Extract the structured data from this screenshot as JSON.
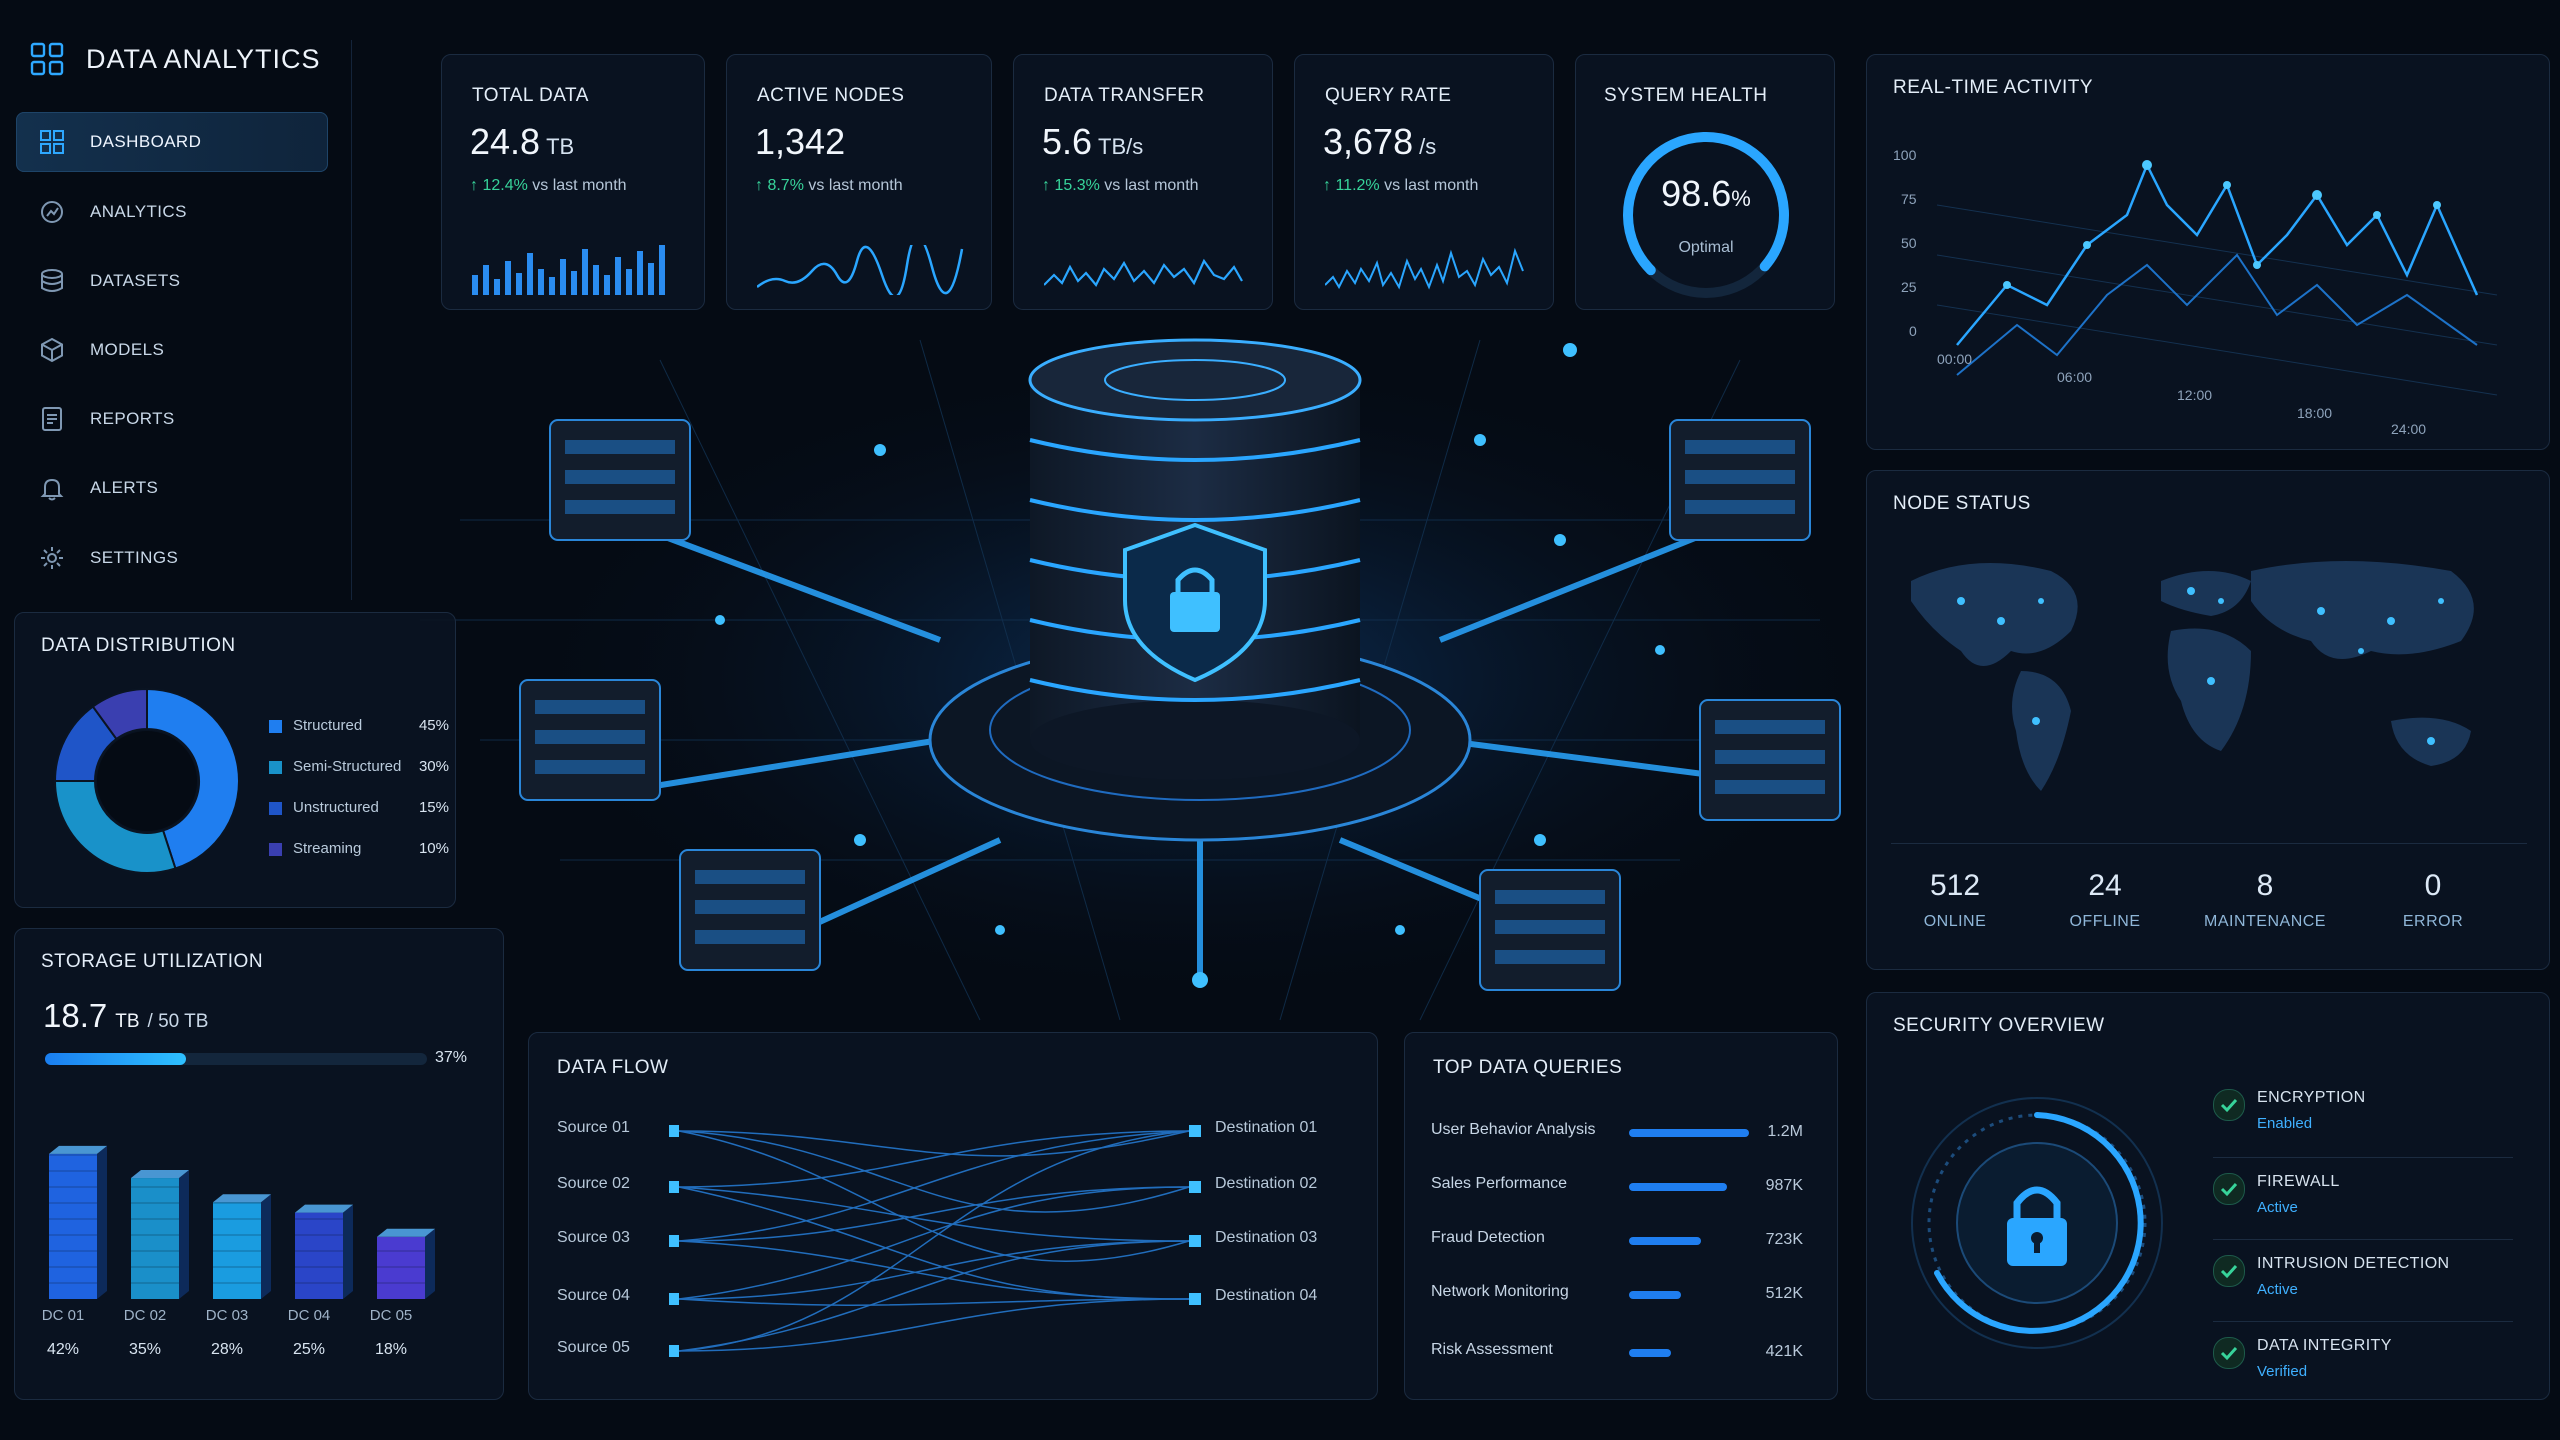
{
  "app": {
    "title": "DATA ANALYTICS"
  },
  "nav": [
    {
      "label": "DASHBOARD",
      "icon": "dashboard-icon",
      "active": true
    },
    {
      "label": "ANALYTICS",
      "icon": "analytics-icon",
      "active": false
    },
    {
      "label": "DATASETS",
      "icon": "database-icon",
      "active": false
    },
    {
      "label": "MODELS",
      "icon": "cube-icon",
      "active": false
    },
    {
      "label": "REPORTS",
      "icon": "document-icon",
      "active": false
    },
    {
      "label": "ALERTS",
      "icon": "bell-icon",
      "active": false
    },
    {
      "label": "SETTINGS",
      "icon": "gear-icon",
      "active": false
    }
  ],
  "kpis": [
    {
      "title": "TOTAL DATA",
      "value": "24.8",
      "unit": "TB",
      "delta": "12.4%",
      "delta_suffix": "vs last month",
      "spark": "bars"
    },
    {
      "title": "ACTIVE NODES",
      "value": "1,342",
      "unit": "",
      "delta": "8.7%",
      "delta_suffix": "vs last month",
      "spark": "line"
    },
    {
      "title": "DATA TRANSFER",
      "value": "5.6",
      "unit": "TB/s",
      "delta": "15.3%",
      "delta_suffix": "vs last month",
      "spark": "wave"
    },
    {
      "title": "QUERY RATE",
      "value": "3,678",
      "unit": "/s",
      "delta": "11.2%",
      "delta_suffix": "vs last month",
      "spark": "jitter"
    }
  ],
  "system_health": {
    "title": "SYSTEM HEALTH",
    "value": "98.6",
    "unit": "%",
    "status": "Optimal",
    "level": 0.986
  },
  "realtime": {
    "title": "REAL-TIME ACTIVITY",
    "y_ticks": [
      "100",
      "75",
      "50",
      "25",
      "0"
    ],
    "x_ticks": [
      "00:00",
      "06:00",
      "12:00",
      "18:00",
      "24:00"
    ]
  },
  "node_status": {
    "title": "NODE STATUS",
    "stats": [
      {
        "value": "512",
        "label": "ONLINE"
      },
      {
        "value": "24",
        "label": "OFFLINE"
      },
      {
        "value": "8",
        "label": "MAINTENANCE"
      },
      {
        "value": "0",
        "label": "ERROR"
      }
    ]
  },
  "distribution": {
    "title": "DATA DISTRIBUTION",
    "items": [
      {
        "name": "Structured",
        "pct": "45%",
        "value": 45,
        "color": "#1f7ef0"
      },
      {
        "name": "Semi-Structured",
        "pct": "30%",
        "value": 30,
        "color": "#1992c9"
      },
      {
        "name": "Unstructured",
        "pct": "15%",
        "value": 15,
        "color": "#1f55c8"
      },
      {
        "name": "Streaming",
        "pct": "10%",
        "value": 10,
        "color": "#3a3fb0"
      }
    ]
  },
  "storage": {
    "title": "STORAGE UTILIZATION",
    "used": "18.7",
    "unit": "TB",
    "total": "/ 50 TB",
    "pct_label": "37%",
    "fill": 0.37,
    "centers": [
      {
        "name": "DC 01",
        "pct": "42%",
        "value": 42,
        "color": "#1f63e0"
      },
      {
        "name": "DC 02",
        "pct": "35%",
        "value": 35,
        "color": "#1a8fc9"
      },
      {
        "name": "DC 03",
        "pct": "28%",
        "value": 28,
        "color": "#1a9ce0"
      },
      {
        "name": "DC 04",
        "pct": "25%",
        "value": 25,
        "color": "#2a45c8"
      },
      {
        "name": "DC 05",
        "pct": "18%",
        "value": 18,
        "color": "#4a3bd0"
      }
    ]
  },
  "dataflow": {
    "title": "DATA FLOW",
    "sources": [
      "Source 01",
      "Source 02",
      "Source 03",
      "Source 04",
      "Source 05"
    ],
    "destinations": [
      "Destination 01",
      "Destination 02",
      "Destination 03",
      "Destination 04"
    ]
  },
  "queries": {
    "title": "TOP DATA QUERIES",
    "rows": [
      {
        "name": "User Behavior Analysis",
        "value": "1.2M",
        "fill": 1.0
      },
      {
        "name": "Sales Performance",
        "value": "987K",
        "fill": 0.82
      },
      {
        "name": "Fraud Detection",
        "value": "723K",
        "fill": 0.6
      },
      {
        "name": "Network Monitoring",
        "value": "512K",
        "fill": 0.43
      },
      {
        "name": "Risk Assessment",
        "value": "421K",
        "fill": 0.35
      }
    ]
  },
  "security": {
    "title": "SECURITY OVERVIEW",
    "items": [
      {
        "title": "ENCRYPTION",
        "status": "Enabled"
      },
      {
        "title": "FIREWALL",
        "status": "Active"
      },
      {
        "title": "INTRUSION DETECTION",
        "status": "Active"
      },
      {
        "title": "DATA INTEGRITY",
        "status": "Verified"
      }
    ]
  },
  "colors": {
    "accent": "#2ea8ff",
    "positive": "#37d39a",
    "panel": "#0a1422",
    "background": "#050b14"
  }
}
